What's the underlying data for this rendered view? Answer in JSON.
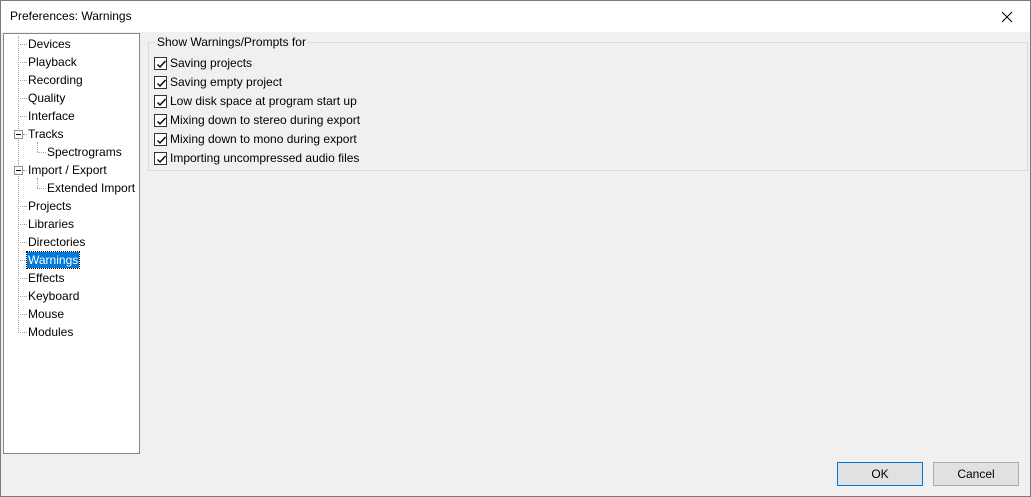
{
  "window": {
    "title": "Preferences: Warnings"
  },
  "tree": {
    "items": [
      {
        "label": "Devices"
      },
      {
        "label": "Playback"
      },
      {
        "label": "Recording"
      },
      {
        "label": "Quality"
      },
      {
        "label": "Interface"
      },
      {
        "label": "Tracks"
      },
      {
        "label": "Spectrograms"
      },
      {
        "label": "Import / Export"
      },
      {
        "label": "Extended Import"
      },
      {
        "label": "Projects"
      },
      {
        "label": "Libraries"
      },
      {
        "label": "Directories"
      },
      {
        "label": "Warnings"
      },
      {
        "label": "Effects"
      },
      {
        "label": "Keyboard"
      },
      {
        "label": "Mouse"
      },
      {
        "label": "Modules"
      }
    ],
    "selected": "Warnings"
  },
  "warnings": {
    "group_label": "Show Warnings/Prompts for",
    "options": [
      {
        "label": "Saving projects",
        "checked": true
      },
      {
        "label": "Saving empty project",
        "checked": true
      },
      {
        "label": "Low disk space at program start up",
        "checked": true
      },
      {
        "label": "Mixing down to stereo during export",
        "checked": true
      },
      {
        "label": "Mixing down to mono during export",
        "checked": true
      },
      {
        "label": "Importing uncompressed audio files",
        "checked": true
      }
    ]
  },
  "buttons": {
    "ok_label": "OK",
    "cancel_label": "Cancel"
  },
  "colors": {
    "selection": "#0078d7",
    "background": "#f0f0f0"
  }
}
